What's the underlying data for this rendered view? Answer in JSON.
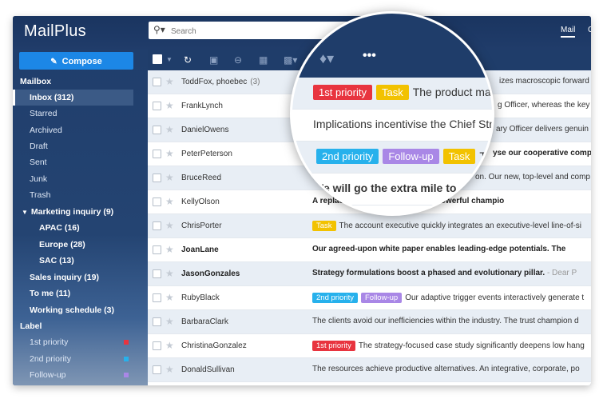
{
  "app": {
    "logo": "MailPlus"
  },
  "search": {
    "placeholder": "Search"
  },
  "top_tabs": [
    "Mail",
    "C"
  ],
  "sidebar": {
    "compose_label": "Compose",
    "mailbox_heading": "Mailbox",
    "items": [
      {
        "label": "Inbox (312)"
      },
      {
        "label": "Starred"
      },
      {
        "label": "Archived"
      },
      {
        "label": "Draft"
      },
      {
        "label": "Sent"
      },
      {
        "label": "Junk"
      },
      {
        "label": "Trash"
      },
      {
        "label": "Marketing inquiry (9)"
      },
      {
        "label": "APAC (16)"
      },
      {
        "label": "Europe (28)"
      },
      {
        "label": "SAC (13)"
      },
      {
        "label": "Sales inquiry (19)"
      },
      {
        "label": "To me (11)"
      },
      {
        "label": "Working schedule (3)"
      }
    ],
    "label_heading": "Label",
    "labels": [
      {
        "label": "1st priority",
        "color": "#e8343f"
      },
      {
        "label": "2nd priority",
        "color": "#27b1ec"
      },
      {
        "label": "Follow-up",
        "color": "#a987e6"
      }
    ]
  },
  "tags": {
    "task": "Task",
    "p1": "1st priority",
    "p2": "2nd priority",
    "fu": "Follow-up"
  },
  "emails": [
    {
      "from": "ToddFox, phoebec",
      "count": "(3)",
      "subject": "izes macroscopic forward p"
    },
    {
      "from": "FrankLynch",
      "subject": "g Officer, whereas the key"
    },
    {
      "from": "DanielOwens",
      "subject": "ary Officer delivers genuin"
    },
    {
      "from": "PeterPeterson",
      "subject": "yse our cooperative comp"
    },
    {
      "from": "BruceReed",
      "subject": "on. Our new, top-level and comp"
    },
    {
      "from": "KellyOlson",
      "subject": "A replace... pillar synergizes the powerful champio"
    },
    {
      "from": "ChrisPorter",
      "subject": "The account executive quickly integrates an executive-level line-of-si"
    },
    {
      "from": "JoanLane",
      "subject": "Our agreed-upon white paper enables leading-edge potentials. The"
    },
    {
      "from": "JasonGonzales",
      "subject": "Strategy formulations boost a phased and evolutionary pillar.",
      "extra": " - Dear P"
    },
    {
      "from": "RubyBlack",
      "subject": "Our adaptive trigger events interactively generate t"
    },
    {
      "from": "BarbaraClark",
      "subject": "The clients avoid our inefficiencies within the industry. The trust champion d"
    },
    {
      "from": "ChristinaGonzalez",
      "subject": "The strategy-focused case study significantly deepens low hang"
    },
    {
      "from": "DonaldSullivan",
      "subject": "The resources achieve productive alternatives. An integrative, corporate, po"
    }
  ],
  "lens": {
    "row1": "The product mana",
    "row2": "Implications incentivise the Chief Strate",
    "row3": "The",
    "row4": "We will go the extra mile to g"
  }
}
